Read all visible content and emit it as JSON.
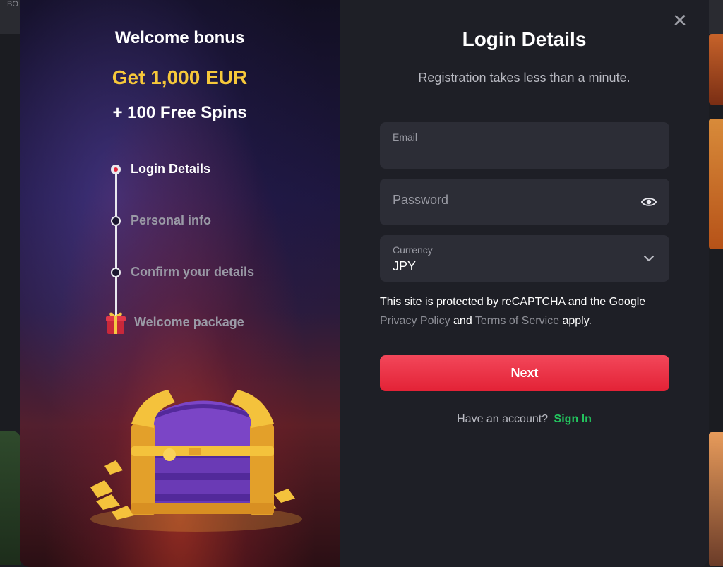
{
  "background": {
    "topbar_text": "BO"
  },
  "promo": {
    "title": "Welcome bonus",
    "amount": "Get 1,000 EUR",
    "spins": "+ 100 Free Spins",
    "steps": [
      {
        "label": "Login Details",
        "active": true
      },
      {
        "label": "Personal info",
        "active": false
      },
      {
        "label": "Confirm your details",
        "active": false
      },
      {
        "label": "Welcome package",
        "active": false,
        "icon": "gift-icon"
      }
    ],
    "image": "treasure-chest"
  },
  "form": {
    "close_icon": "close-icon",
    "title": "Login Details",
    "subtitle": "Registration takes less than a minute.",
    "email": {
      "label": "Email",
      "value": ""
    },
    "password": {
      "placeholder": "Password",
      "icon": "eye-icon"
    },
    "currency": {
      "label": "Currency",
      "value": "JPY",
      "icon": "chevron-down-icon"
    },
    "recaptcha": {
      "prefix": "This site is protected by reCAPTCHA and the Google",
      "privacy_link": "Privacy Policy",
      "and": "and",
      "terms_link": "Terms of Service",
      "suffix": "apply."
    },
    "next_label": "Next",
    "have_account": "Have an account?",
    "sign_in": "Sign In"
  },
  "colors": {
    "accent_red": "#e32236",
    "gold": "#f7c83a",
    "sign_in_green": "#23c45e"
  }
}
